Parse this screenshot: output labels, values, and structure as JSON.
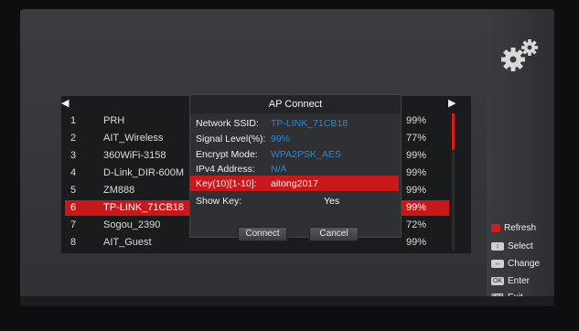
{
  "wifi_list": {
    "rows": [
      {
        "num": "1",
        "ssid": "PRH",
        "signal": "99%"
      },
      {
        "num": "2",
        "ssid": "AIT_Wireless",
        "signal": "77%"
      },
      {
        "num": "3",
        "ssid": "360WiFi-3158",
        "signal": "99%"
      },
      {
        "num": "4",
        "ssid": "D-Link_DIR-600M",
        "signal": "99%"
      },
      {
        "num": "5",
        "ssid": "ZM888",
        "signal": "99%"
      },
      {
        "num": "6",
        "ssid": "TP-LINK_71CB18",
        "signal": "99%"
      },
      {
        "num": "7",
        "ssid": "Sogou_2390",
        "signal": "72%"
      },
      {
        "num": "8",
        "ssid": "AIT_Guest",
        "signal": "99%"
      }
    ],
    "selected_index": 5
  },
  "dialog": {
    "title": "AP Connect",
    "network_ssid_label": "Network SSID:",
    "network_ssid_value": "TP-LINK_71CB18",
    "signal_label": "Signal Level(%):",
    "signal_value": "99%",
    "encrypt_label": "Encrypt Mode:",
    "encrypt_value": "WPA2PSK_AES",
    "ipv4_label": "IPv4 Address:",
    "ipv4_value": "N/A",
    "key_label": "Key(10)[1-10]:",
    "key_value": "aitong2017",
    "showkey_label": "Show Key:",
    "showkey_value": "Yes",
    "connect_label": "Connect",
    "cancel_label": "Cancel"
  },
  "legend": {
    "refresh": "Refresh",
    "select": "Select",
    "change": "Change",
    "enter": "Enter",
    "exit": "Exit",
    "ok_icon": "OK",
    "exit_icon": "EXIT"
  },
  "colors": {
    "accent": "#c8181b",
    "value_blue": "#2a86d6"
  }
}
